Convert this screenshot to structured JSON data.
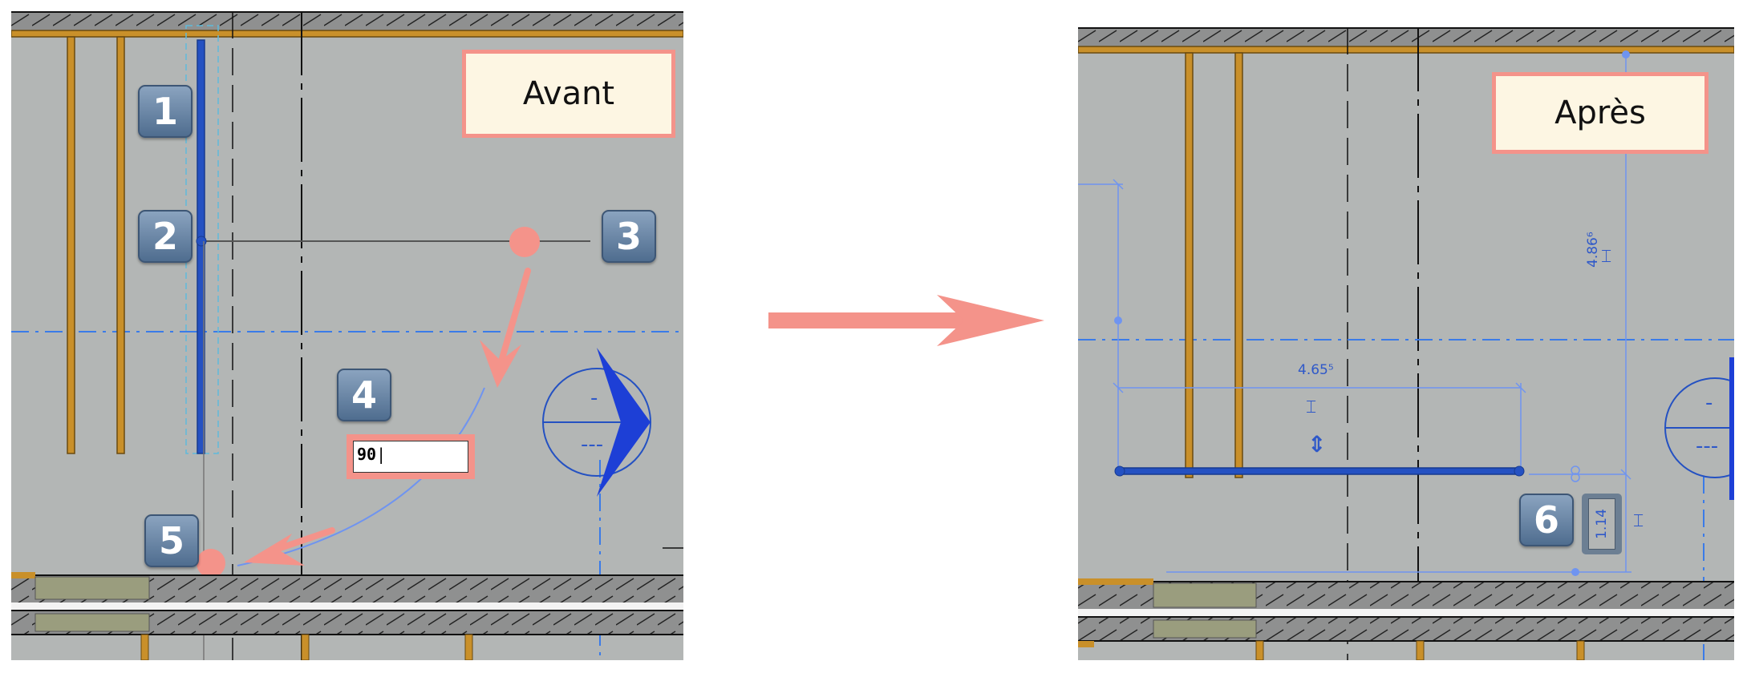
{
  "left": {
    "label": "Avant",
    "badges": [
      "1",
      "2",
      "3",
      "4",
      "5"
    ],
    "input_value": "90",
    "section_marker": {
      "top": "-",
      "bottom": "---"
    }
  },
  "right": {
    "label": "Après",
    "badge": "6",
    "dim_horizontal": "4.65⁵",
    "dim_vertical": "4.86⁶",
    "dim_temp": "1.14",
    "section_marker": {
      "top": "-",
      "bottom": "---"
    }
  },
  "colors": {
    "background": "#b3b6b5",
    "wall_fill": "#8f9090",
    "wall_finish": "#c9902a",
    "selection_blue": "#2451c2",
    "dim_blue": "#6f94f0",
    "annotation_pink": "#f4938a",
    "label_bg": "#fdf6e3",
    "badge": "#5f7b9c"
  },
  "icons": [
    "flip-arrows-icon",
    "dimension-lock-icon",
    "transition-arrow-icon"
  ]
}
